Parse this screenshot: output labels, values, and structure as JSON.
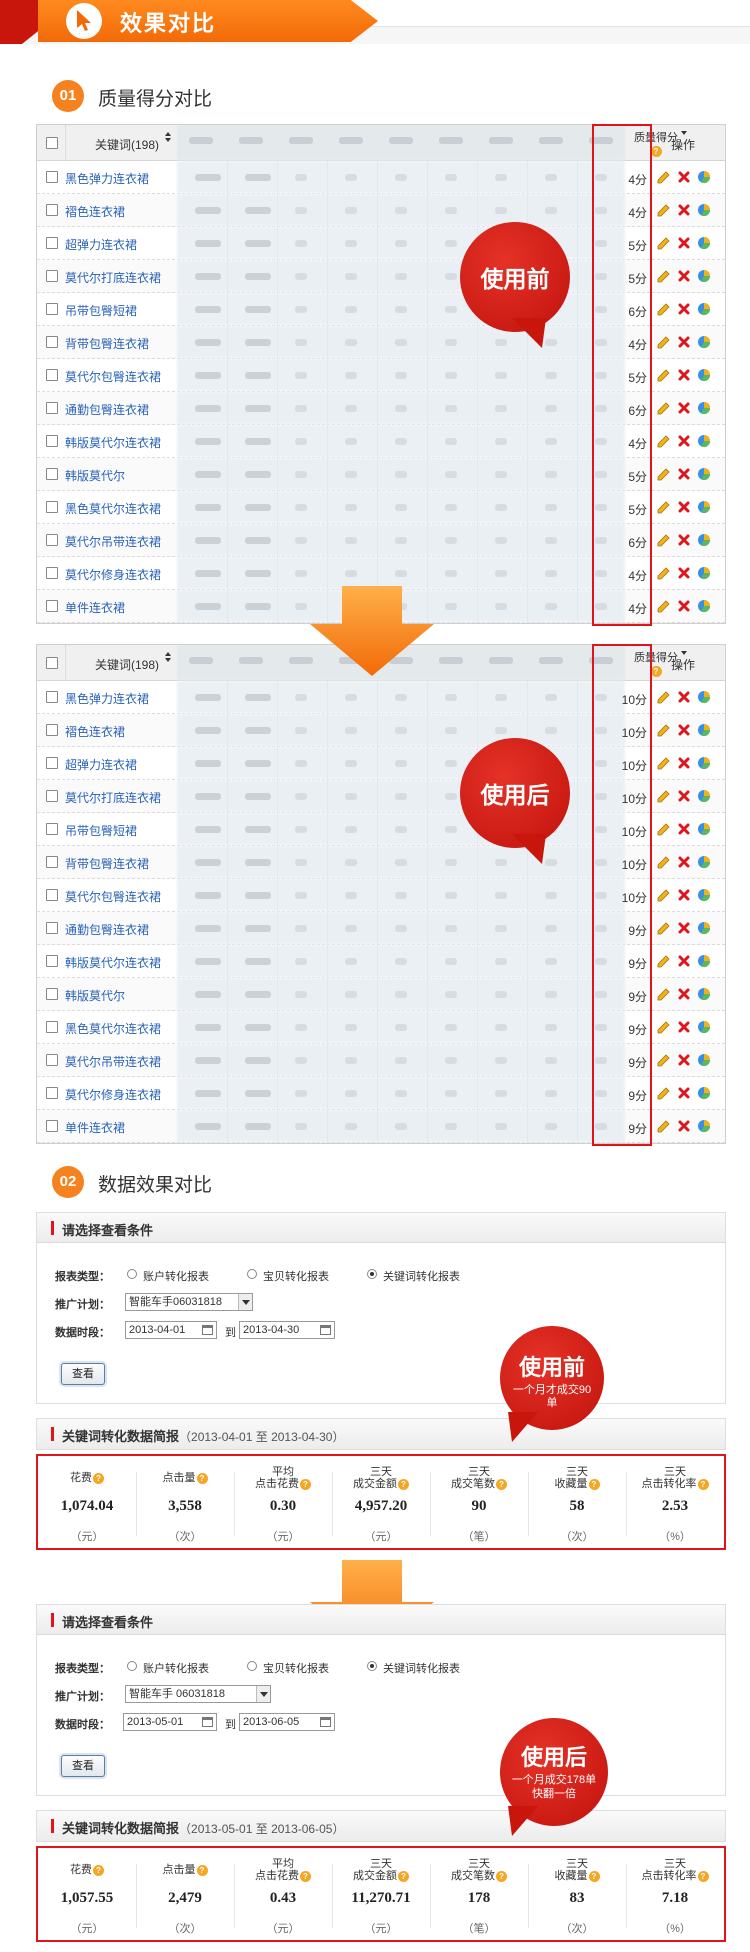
{
  "banner": {
    "title": "效果对比"
  },
  "section1": {
    "number": "01",
    "title": "质量得分对比"
  },
  "section2": {
    "number": "02",
    "title": "数据效果对比"
  },
  "kw_table": {
    "keyword_header": "关键词(198)",
    "quality_header": "质量得分",
    "ops_header": "操作",
    "keywords": [
      "黑色弹力连衣裙",
      "褶色连衣裙",
      "超弹力连衣裙",
      "莫代尔打底连衣裙",
      "吊带包臀短裙",
      "背带包臀连衣裙",
      "莫代尔包臀连衣裙",
      "通勤包臀连衣裙",
      "韩版莫代尔连衣裙",
      "韩版莫代尔",
      "黑色莫代尔连衣裙",
      "莫代尔吊带连衣裙",
      "莫代尔修身连衣裙",
      "单件连衣裙"
    ],
    "before_scores": [
      "4分",
      "4分",
      "5分",
      "5分",
      "6分",
      "4分",
      "5分",
      "6分",
      "4分",
      "5分",
      "5分",
      "6分",
      "4分",
      "4分"
    ],
    "after_scores": [
      "10分",
      "10分",
      "10分",
      "10分",
      "10分",
      "10分",
      "10分",
      "9分",
      "9分",
      "9分",
      "9分",
      "9分",
      "9分",
      "9分"
    ]
  },
  "bubbles": {
    "before": "使用前",
    "after": "使用后",
    "before2_title": "使用前",
    "before2_note": "一个月才成交90单",
    "after2_title": "使用后",
    "after2_note_line1": "一个月成交178单",
    "after2_note_line2": "快翻一倍"
  },
  "query_panel": {
    "title": "请选择查看条件",
    "report_type_label": "报表类型：",
    "radio_options": [
      "账户转化报表",
      "宝贝转化报表",
      "关键词转化报表"
    ],
    "plan_label": "推广计划：",
    "period_label": "数据时段：",
    "to_label": "到",
    "query_button": "查看"
  },
  "before": {
    "plan_value": "智能车手06031818",
    "date_from": "2013-04-01",
    "date_to": "2013-04-30",
    "summary_title": "关键词转化数据简报",
    "summary_range": "（2013-04-01 至 2013-04-30）"
  },
  "after": {
    "plan_value": "智能车手 06031818",
    "date_from": "2013-05-01",
    "date_to": "2013-06-05",
    "summary_title": "关键词转化数据简报",
    "summary_range": "（2013-05-01 至 2013-06-05）"
  },
  "stat_labels": [
    {
      "line1": "",
      "line2": "花费",
      "unit": "（元）"
    },
    {
      "line1": "",
      "line2": "点击量",
      "unit": "（次）"
    },
    {
      "line1": "平均",
      "line2": "点击花费",
      "unit": "（元）"
    },
    {
      "line1": "三天",
      "line2": "成交金额",
      "unit": "（元）"
    },
    {
      "line1": "三天",
      "line2": "成交笔数",
      "unit": "（笔）"
    },
    {
      "line1": "三天",
      "line2": "收藏量",
      "unit": "（次）"
    },
    {
      "line1": "三天",
      "line2": "点击转化率",
      "unit": "（%）"
    }
  ],
  "stats_before": [
    "1,074.04",
    "3,558",
    "0.30",
    "4,957.20",
    "90",
    "58",
    "2.53"
  ],
  "stats_after": [
    "1,057.55",
    "2,479",
    "0.43",
    "11,270.71",
    "178",
    "83",
    "7.18"
  ],
  "colors": {
    "accent_orange": "#f5821f",
    "accent_red": "#e0141b",
    "bubble_red": "#c8160c",
    "link_blue": "#2a63b8"
  },
  "icons": [
    "cursor-icon",
    "edit-icon",
    "delete-icon",
    "chart-icon",
    "help-icon",
    "calendar-icon",
    "sort-icon"
  ]
}
